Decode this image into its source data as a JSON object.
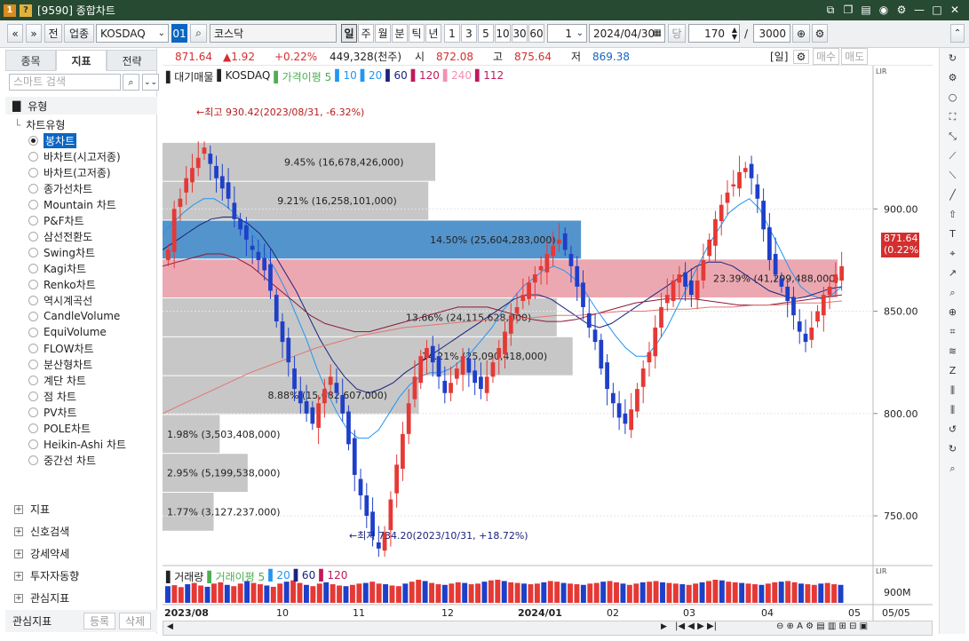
{
  "window": {
    "badge": "1",
    "badge2": "?",
    "title": "[9590] 종합차트"
  },
  "toolbar": {
    "jeon": "전",
    "upjong": "업종",
    "symbol": "KOSDAQ",
    "code": "01",
    "name": "코스닥",
    "periods": [
      "일",
      "주",
      "월",
      "분",
      "틱",
      "년"
    ],
    "nums": [
      "1",
      "3",
      "5",
      "10",
      "30",
      "60"
    ],
    "count": "1",
    "date": "2024/04/30",
    "dang": "당",
    "bars": "170",
    "slash": "/",
    "max": "3000"
  },
  "left": {
    "tabs": [
      "종목",
      "지표",
      "전략"
    ],
    "search_placeholder": "스마트 검색",
    "group": "유형",
    "root": "차트유형",
    "items": [
      "봉차트",
      "바차트(시고저종)",
      "바차트(고저종)",
      "종가선차트",
      "Mountain 차트",
      "P&F차트",
      "삼선전환도",
      "Swing차트",
      "Kagi차트",
      "Renko차트",
      "역시계곡선",
      "CandleVolume",
      "EquiVolume",
      "FLOW차트",
      "분산형차트",
      "계단 차트",
      "점 차트",
      "PV차트",
      "POLE차트",
      "Heikin-Ashi 차트",
      "중간선 차트"
    ],
    "categories": [
      "지표",
      "신호검색",
      "강세약세",
      "투자자동향",
      "관심지표"
    ],
    "bottom": {
      "label": "관심지표",
      "add": "등록",
      "del": "삭제"
    }
  },
  "pricebar": {
    "price": "871.64",
    "change": "▲1.92",
    "pct": "+0.22%",
    "volume": "449,328(천주)",
    "open_label": "시",
    "open": "872.08",
    "high_label": "고",
    "high": "875.64",
    "low_label": "저",
    "low": "869.38",
    "period_tag": "[일]",
    "buy": "매수",
    "sell": "매도"
  },
  "legend": {
    "items": [
      {
        "t": "대기매물",
        "c": "#222"
      },
      {
        "t": "KOSDAQ",
        "c": "#222"
      },
      {
        "t": "가격이평 5",
        "c": "#4caf50"
      },
      {
        "t": "10",
        "c": "#2196f3"
      },
      {
        "t": "20",
        "c": "#2196f3"
      },
      {
        "t": "60",
        "c": "#1a237e"
      },
      {
        "t": "120",
        "c": "#c2185b"
      },
      {
        "t": "240",
        "c": "#f48fb1"
      },
      {
        "t": "112",
        "c": "#c2185b"
      }
    ]
  },
  "volume_legend": {
    "items": [
      {
        "t": "거래량",
        "c": "#222"
      },
      {
        "t": "거래이평 5",
        "c": "#4caf50"
      },
      {
        "t": "20",
        "c": "#2196f3"
      },
      {
        "t": "60",
        "c": "#1a237e"
      },
      {
        "t": "120",
        "c": "#c2185b"
      }
    ]
  },
  "annotations": {
    "high": "←최고 930.42(2023/08/31, -6.32%)",
    "low": "←최저 734.20(2023/10/31, +18.72%)",
    "last_price": "871.64",
    "last_pct": "(0.22%)",
    "volume_axis": "900M",
    "lbl_top": "LIR"
  },
  "chart_data": {
    "type": "candlestick",
    "title": "",
    "ylim": [
      727,
      970
    ],
    "y_ticks": [
      750,
      800,
      850,
      900
    ],
    "x_labels": [
      "2023/08",
      "10",
      "11",
      "12",
      "2024/01",
      "02",
      "03",
      "04",
      "05",
      "05/05"
    ],
    "volume_profile": [
      {
        "range": [
          913.5,
          932.5
        ],
        "pct": "9.45%",
        "volume": "16,678,426,000"
      },
      {
        "range": [
          894.5,
          913.5
        ],
        "pct": "9.21%",
        "volume": "16,258,101,000"
      },
      {
        "range": [
          875.5,
          894.5
        ],
        "pct": "14.50%",
        "volume": "25,604,283,000",
        "highlight": "blue"
      },
      {
        "range": [
          856.5,
          875.5
        ],
        "pct": "23.39%",
        "volume": "41,299,488,000",
        "highlight": "red"
      },
      {
        "range": [
          837.5,
          856.5
        ],
        "pct": "13.66%",
        "volume": "24,115,628,000"
      },
      {
        "range": [
          818.5,
          837.5
        ],
        "pct": "14.21%",
        "volume": "25,090,418,000"
      },
      {
        "range": [
          799.5,
          818.5
        ],
        "pct": "8.88%",
        "volume": "15,682,607,000"
      },
      {
        "range": [
          780.5,
          799.5
        ],
        "pct": "1.98%",
        "volume": "3,503,408,000"
      },
      {
        "range": [
          761.5,
          780.5
        ],
        "pct": "2.95%",
        "volume": "5,199,538,000"
      },
      {
        "range": [
          742.5,
          761.5
        ],
        "pct": "1.77%",
        "volume": "3,127,237,000"
      }
    ],
    "close_path": [
      880,
      900,
      905,
      915,
      920,
      925,
      930,
      922,
      915,
      910,
      905,
      895,
      890,
      885,
      880,
      875,
      870,
      860,
      845,
      835,
      825,
      812,
      805,
      800,
      795,
      805,
      812,
      818,
      810,
      800,
      785,
      770,
      760,
      750,
      740,
      734,
      742,
      758,
      775,
      790,
      805,
      818,
      828,
      832,
      825,
      818,
      810,
      815,
      822,
      828,
      820,
      815,
      812,
      818,
      825,
      832,
      840,
      848,
      852,
      858,
      864,
      868,
      872,
      878,
      882,
      885,
      880,
      872,
      862,
      852,
      842,
      835,
      822,
      812,
      805,
      798,
      795,
      802,
      812,
      822,
      830,
      842,
      852,
      858,
      865,
      868,
      862,
      858,
      865,
      875,
      885,
      895,
      902,
      908,
      912,
      918,
      920,
      915,
      905,
      890,
      875,
      868,
      862,
      855,
      848,
      840,
      835,
      842,
      850,
      858,
      862,
      868,
      872
    ],
    "ma_lines": [
      {
        "name": "20",
        "color": "#2196f3",
        "values": [
          888,
          893,
          898,
          902,
          905,
          905,
          902,
          898,
          893,
          886,
          878,
          870,
          860,
          848,
          836,
          822,
          810,
          800,
          792,
          788,
          788,
          792,
          800,
          808,
          814,
          818,
          820,
          820,
          822,
          826,
          830,
          836,
          842,
          850,
          856,
          862,
          866,
          870,
          872,
          870,
          866,
          860,
          852,
          845,
          838,
          832,
          828,
          828,
          834,
          842,
          852,
          862,
          872,
          882,
          890,
          898,
          902,
          905,
          900,
          890,
          880,
          870,
          862,
          858,
          856,
          858,
          862
        ]
      },
      {
        "name": "60",
        "color": "#1a237e",
        "values": [
          880,
          884,
          888,
          892,
          895,
          896,
          896,
          893,
          888,
          880,
          870,
          860,
          848,
          836,
          826,
          818,
          812,
          810,
          812,
          815,
          820,
          824,
          828,
          832,
          836,
          840,
          844,
          848,
          852,
          856,
          858,
          858,
          856,
          852,
          848,
          844,
          842,
          844,
          848,
          852,
          856,
          860,
          864,
          868,
          872,
          874,
          874,
          872,
          868,
          864,
          860,
          858,
          856,
          857,
          859,
          861,
          862
        ]
      },
      {
        "name": "120",
        "color": "#8b1a3a",
        "values": [
          872,
          874,
          876,
          878,
          878,
          876,
          872,
          866,
          860,
          854,
          848,
          844,
          842,
          840,
          840,
          842,
          844,
          846,
          848,
          850,
          852,
          852,
          852,
          850,
          848,
          846,
          845,
          845,
          846,
          848,
          850,
          852,
          854,
          855,
          856,
          856,
          856,
          855,
          854,
          853,
          853,
          853,
          854,
          855,
          856,
          857,
          858
        ]
      },
      {
        "name": "240",
        "color": "#e57373",
        "values": [
          800,
          805,
          810,
          815,
          820,
          824,
          828,
          832,
          835,
          838,
          840,
          842,
          843,
          844,
          845,
          846,
          846,
          847,
          848,
          848,
          849,
          850,
          850,
          851,
          851,
          852,
          852,
          853,
          853,
          854,
          854,
          855
        ]
      }
    ],
    "volume": [
      260,
      275,
      245,
      290,
      310,
      270,
      250,
      300,
      320,
      280,
      260,
      300,
      340,
      310,
      290,
      270,
      250,
      300,
      330,
      350,
      310,
      280,
      260,
      300,
      320,
      290,
      270,
      260,
      280,
      300,
      310,
      330,
      300,
      290,
      270,
      260,
      300,
      330,
      360,
      340,
      310,
      290,
      280,
      300,
      320,
      310,
      290,
      300,
      330,
      350,
      360,
      340,
      320,
      310,
      300,
      290,
      300,
      320,
      340,
      330,
      310,
      300,
      290,
      280,
      300,
      310,
      330,
      340,
      320,
      300,
      280,
      300,
      320,
      330,
      340,
      320,
      310,
      300,
      290,
      280,
      300,
      320,
      340,
      360,
      350,
      330,
      320,
      310,
      300,
      290,
      280,
      300,
      320,
      330,
      340,
      320,
      300,
      290,
      280,
      300,
      310,
      290,
      280
    ]
  }
}
